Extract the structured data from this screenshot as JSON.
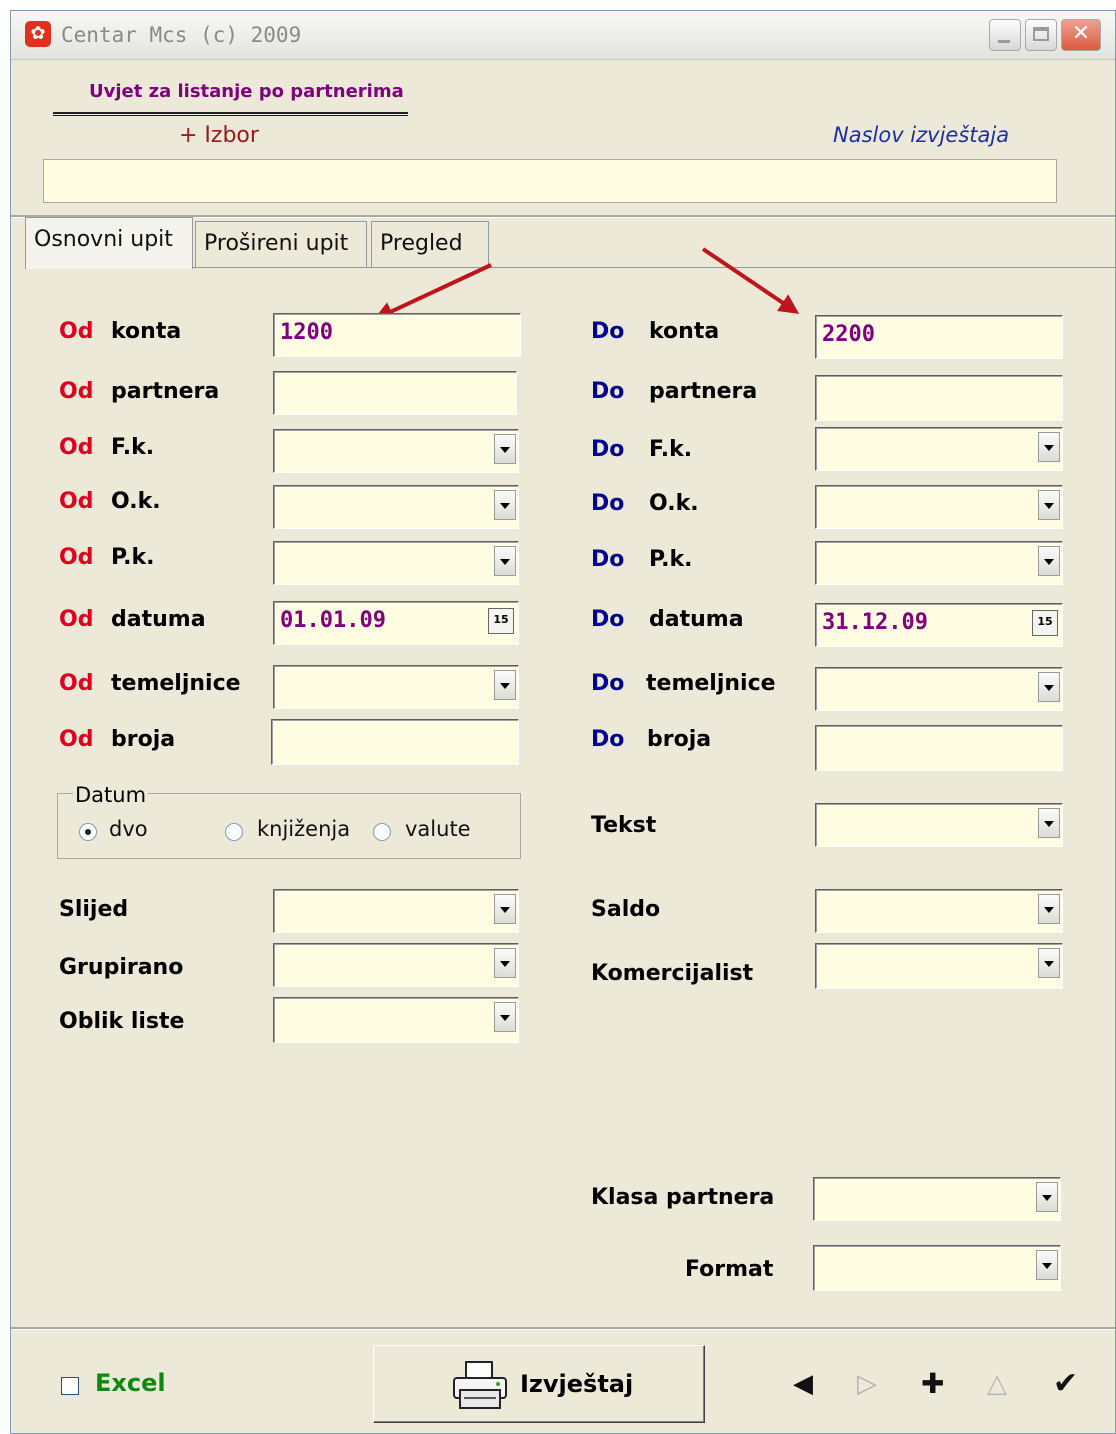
{
  "window": {
    "title": "Centar Mcs (c) 2009"
  },
  "header": {
    "title": "Uvjet za listanje po partnerima",
    "izbor": "+ Izbor",
    "naslov_label": "Naslov izvještaja",
    "naslov_value": ""
  },
  "tabs": [
    "Osnovni upit",
    "Prošireni upit",
    "Pregled"
  ],
  "od_prefix": "Od",
  "do_prefix": "Do",
  "left": {
    "konta": {
      "label": "konta",
      "value": "1200"
    },
    "partnera": {
      "label": "partnera",
      "value": ""
    },
    "fk": {
      "label": "F.k.",
      "value": ""
    },
    "ok": {
      "label": "O.k.",
      "value": ""
    },
    "pk": {
      "label": "P.k.",
      "value": ""
    },
    "datuma": {
      "label": "datuma",
      "value": "01.01.09"
    },
    "temeljnice": {
      "label": "temeljnice",
      "value": ""
    },
    "broja": {
      "label": "broja",
      "value": ""
    }
  },
  "right": {
    "konta": {
      "label": "konta",
      "value": "2200"
    },
    "partnera": {
      "label": "partnera",
      "value": ""
    },
    "fk": {
      "label": "F.k.",
      "value": ""
    },
    "ok": {
      "label": "O.k.",
      "value": ""
    },
    "pk": {
      "label": "P.k.",
      "value": ""
    },
    "datuma": {
      "label": "datuma",
      "value": "31.12.09"
    },
    "temeljnice": {
      "label": "temeljnice",
      "value": ""
    },
    "broja": {
      "label": "broja",
      "value": ""
    }
  },
  "calendar_icon_text": "15",
  "datum_group": {
    "title": "Datum",
    "options": [
      "dvo",
      "knjiženja",
      "valute"
    ],
    "selected": "dvo"
  },
  "extra_left": {
    "slijed": "Slijed",
    "grupirano": "Grupirano",
    "oblik_liste": "Oblik liste"
  },
  "extra_right": {
    "tekst": "Tekst",
    "saldo": "Saldo",
    "komercijalist": "Komercijalist",
    "klasa_partnera": "Klasa partnera",
    "format": "Format"
  },
  "footer": {
    "excel_label": "Excel",
    "excel_checked": false,
    "report_button": "Izvještaj",
    "nav_icons": [
      "prev-icon",
      "next-icon",
      "add-icon",
      "up-icon",
      "confirm-icon"
    ]
  },
  "colors": {
    "field_bg": "#fffde1",
    "od_color": "#e0001e",
    "do_color": "#000090",
    "value_color": "#800080",
    "arrow_color": "#c0141a"
  }
}
